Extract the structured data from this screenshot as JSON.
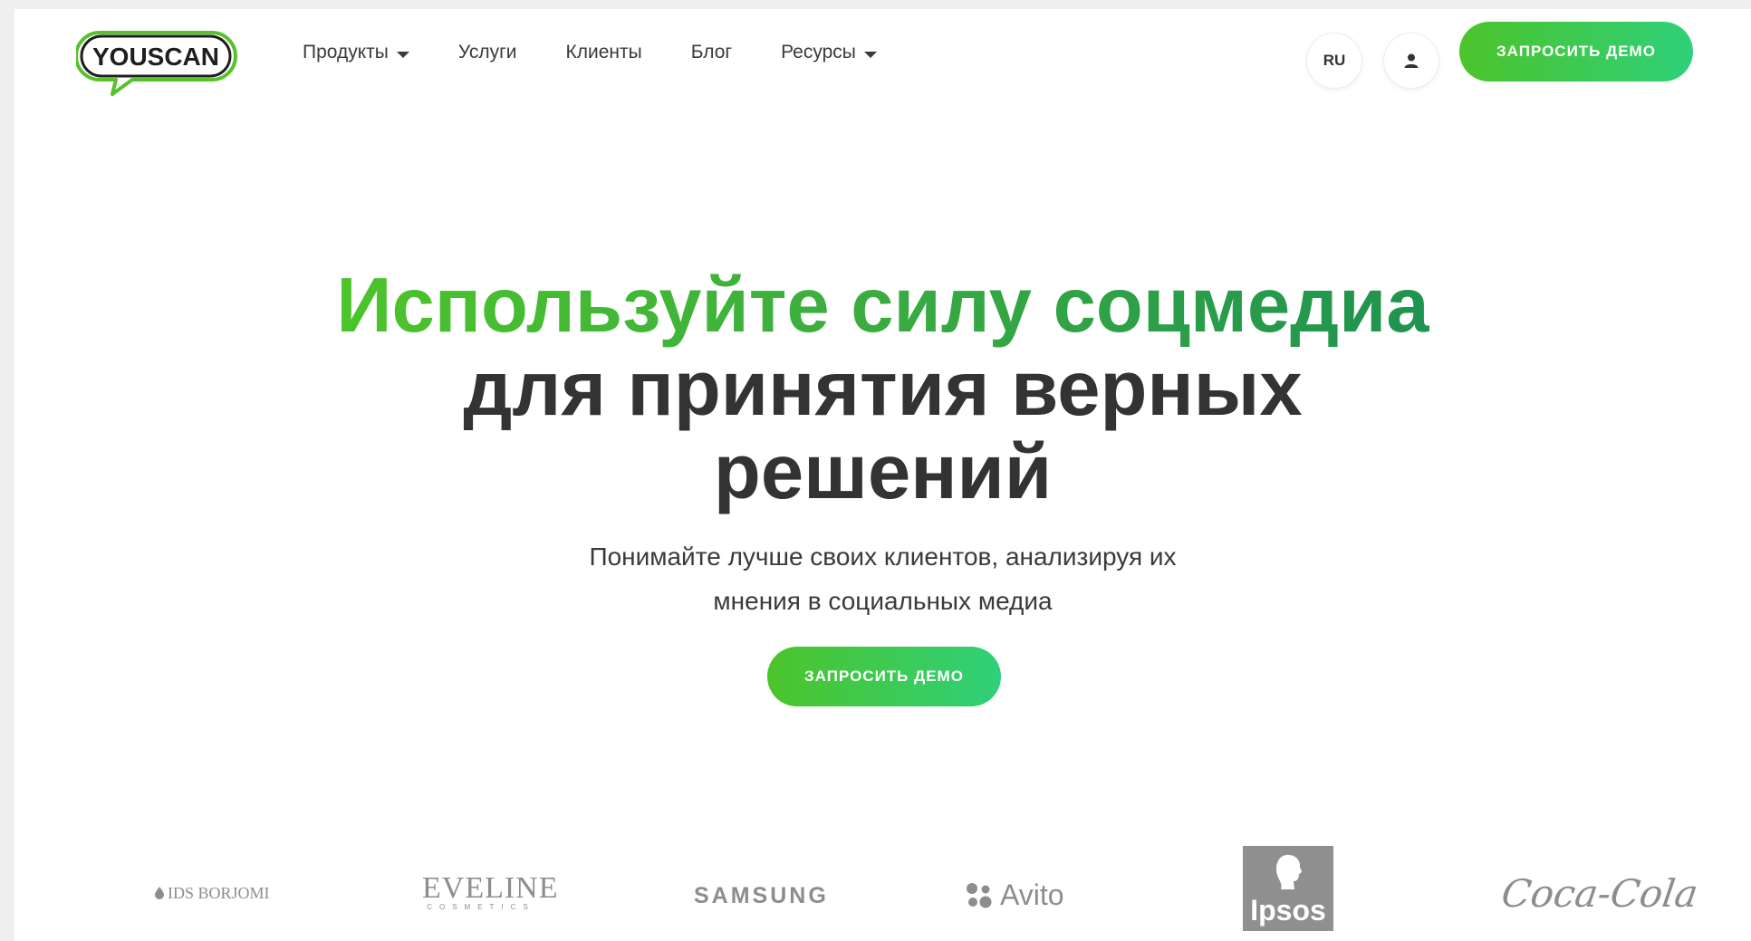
{
  "header": {
    "logo_text": "YOUSCAN",
    "nav": [
      {
        "label": "Продукты",
        "has_dropdown": true
      },
      {
        "label": "Услуги",
        "has_dropdown": false
      },
      {
        "label": "Клиенты",
        "has_dropdown": false
      },
      {
        "label": "Блог",
        "has_dropdown": false
      },
      {
        "label": "Ресурсы",
        "has_dropdown": true
      }
    ],
    "language": "RU",
    "user_icon": "user-icon",
    "cta_label": "ЗАПРОСИТЬ ДЕМО"
  },
  "hero": {
    "title_accent": "Используйте силу соцмедиа",
    "title_line2": "для принятия верных",
    "title_line3": "решений",
    "subtitle_line1": "Понимайте лучше своих клиентов, анализируя их",
    "subtitle_line2": "мнения в социальных медиа",
    "cta_label": "ЗАПРОСИТЬ ДЕМО"
  },
  "client_logos": [
    {
      "name": "IDS BORJOMI",
      "text": "IDS BORJOMI"
    },
    {
      "name": "Eveline Cosmetics",
      "text": "EVELINE",
      "subtext": "COSMETICS"
    },
    {
      "name": "Samsung",
      "text": "SAMSUNG"
    },
    {
      "name": "Avito",
      "text": "Avito"
    },
    {
      "name": "Ipsos",
      "text": "Ipsos"
    },
    {
      "name": "Coca-Cola",
      "text": "Coca-Cola"
    }
  ],
  "colors": {
    "accent_start": "#4cc42a",
    "accent_end": "#2fd07a",
    "heading_dark": "#333333",
    "text": "#3a3a3a",
    "logo_grey": "#8d8d8d"
  }
}
